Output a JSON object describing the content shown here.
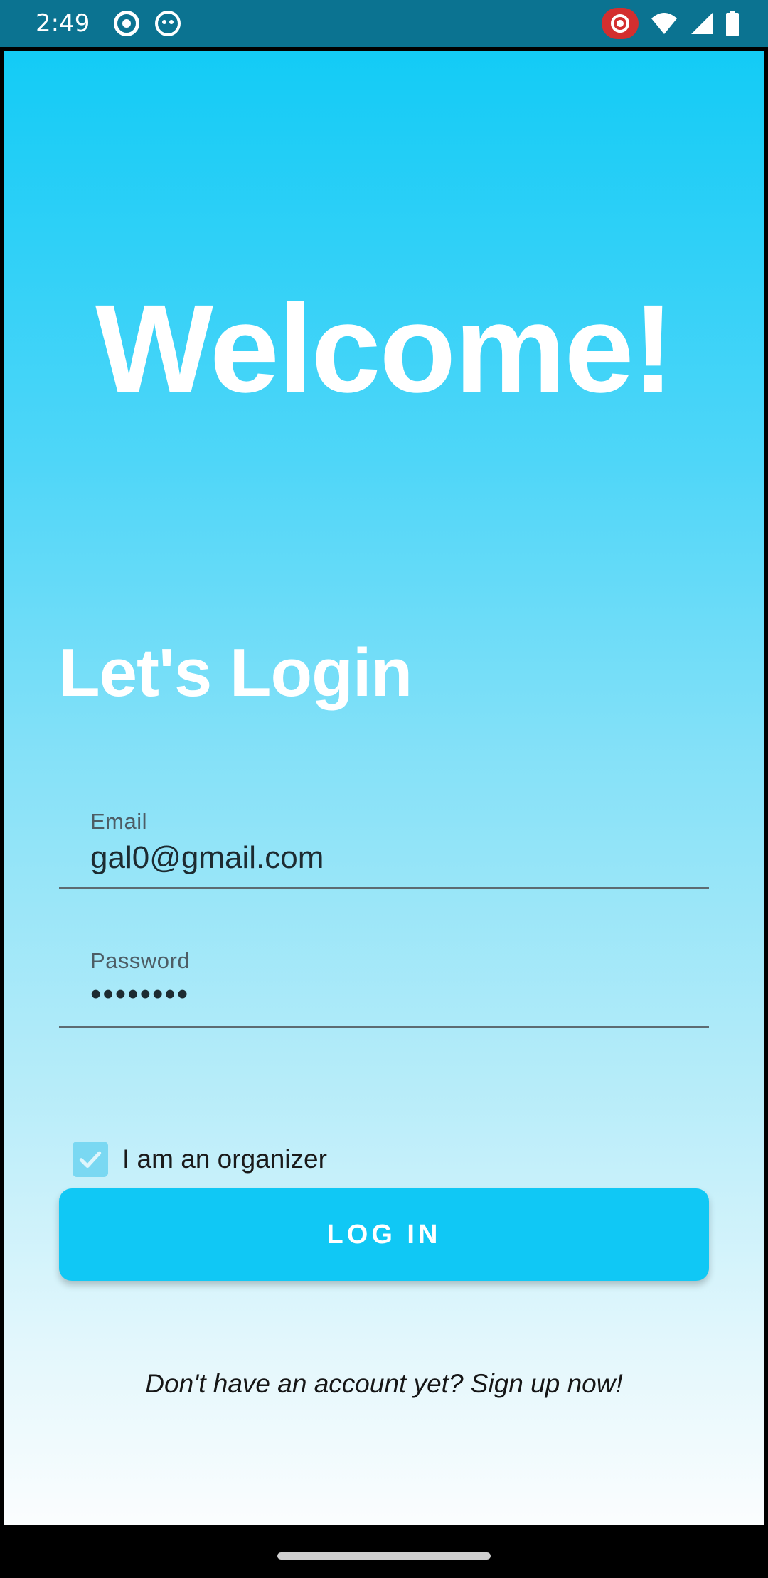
{
  "status_bar": {
    "time": "2:49",
    "icons": [
      "screen-cast-icon",
      "android-bot-icon",
      "screen-record-icon",
      "wifi-icon",
      "cell-signal-icon",
      "battery-icon"
    ]
  },
  "screen": {
    "welcome_title": "Welcome!",
    "login_heading": "Let's Login",
    "email": {
      "label": "Email",
      "value": "gal0@gmail.com"
    },
    "password": {
      "label": "Password",
      "value": "••••••••"
    },
    "organizer_checkbox": {
      "label": "I am an organizer",
      "checked": true
    },
    "login_button": "LOG IN",
    "signup_link": "Don't have an account yet? Sign up now!"
  },
  "colors": {
    "status_bar": "#0b7391",
    "gradient_top": "#13cbf6",
    "gradient_bottom": "#fbfdfe",
    "button": "#10c8f5",
    "checkbox": "#7ad8f2"
  }
}
